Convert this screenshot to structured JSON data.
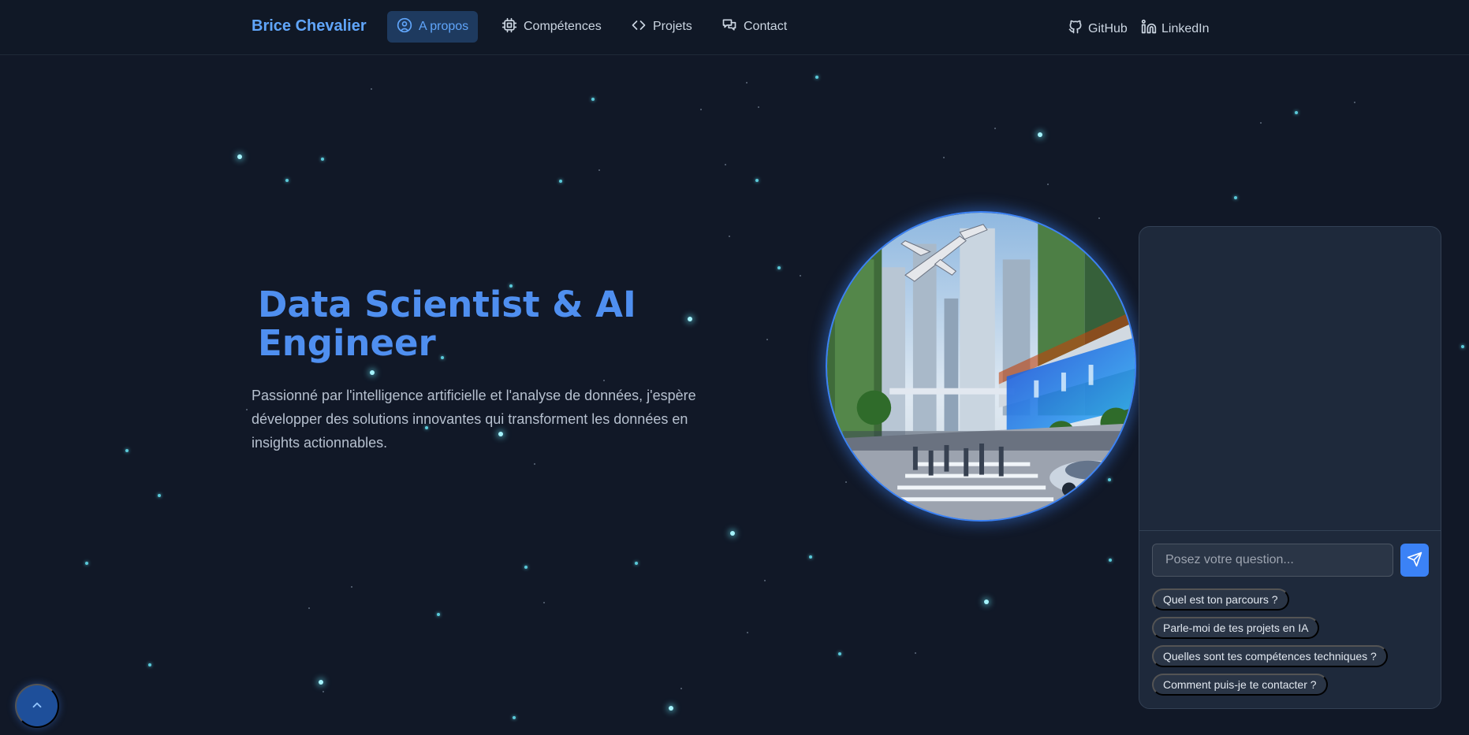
{
  "header": {
    "brand": "Brice Chevalier",
    "nav": [
      {
        "label": "A propos",
        "icon": "user-circle-icon",
        "active": true
      },
      {
        "label": "Compétences",
        "icon": "cpu-icon",
        "active": false
      },
      {
        "label": "Projets",
        "icon": "code-icon",
        "active": false
      },
      {
        "label": "Contact",
        "icon": "chat-bubbles-icon",
        "active": false
      }
    ],
    "links": [
      {
        "label": "GitHub",
        "icon": "github-icon"
      },
      {
        "label": "LinkedIn",
        "icon": "linkedin-icon"
      }
    ]
  },
  "hero": {
    "title": "Data Scientist & AI Engineer",
    "description": "Passionné par l'intelligence artificielle et l'analyse de données, j'espère développer des solutions innovantes qui transforment les données en insights actionnables."
  },
  "image": {
    "icon": "futuristic-city-illustration"
  },
  "chat": {
    "input_placeholder": "Posez votre question...",
    "send_icon": "send-icon",
    "suggestions": [
      "Quel est ton parcours ?",
      "Parle-moi de tes projets en IA",
      "Quelles sont tes compétences techniques ?",
      "Comment puis-je te contacter ?"
    ]
  },
  "scroll_top_icon": "chevron-up-icon",
  "colors": {
    "background": "#111827",
    "accent": "#3b82f6",
    "title": "#4f8ff0",
    "star": "#67e8f9"
  }
}
